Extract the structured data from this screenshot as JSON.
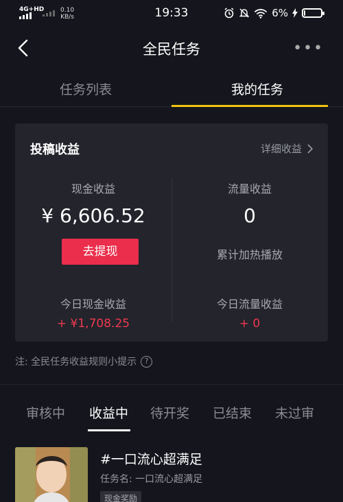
{
  "status_bar": {
    "network": "4G+HD",
    "speed_value": "0.10",
    "speed_unit": "KB/s",
    "time": "19:33",
    "battery_percent": "6%",
    "battery_level": 0.06
  },
  "nav": {
    "title": "全民任务",
    "more": "•••"
  },
  "top_tabs": [
    {
      "label": "任务列表",
      "active": false
    },
    {
      "label": "我的任务",
      "active": true
    }
  ],
  "earnings": {
    "title": "投稿收益",
    "detail_link": "详细收益",
    "cash_label": "现金收益",
    "cash_value": "¥ 6,606.52",
    "withdraw_label": "去提现",
    "traffic_label": "流量收益",
    "traffic_value": "0",
    "traffic_caption": "累计加热播放",
    "today_cash_label": "今日现金收益",
    "today_cash_value": "+ ¥1,708.25",
    "today_traffic_label": "今日流量收益",
    "today_traffic_value": "+ 0"
  },
  "note": {
    "text": "注: 全民任务收益规则小提示"
  },
  "status_tabs": [
    {
      "label": "审核中",
      "active": false
    },
    {
      "label": "收益中",
      "active": true
    },
    {
      "label": "待开奖",
      "active": false
    },
    {
      "label": "已结束",
      "active": false
    },
    {
      "label": "未过审",
      "active": false
    }
  ],
  "task": {
    "title": "#一口流心超满足",
    "name": "任务名: 一口流心超满足",
    "tag": "现金奖励"
  },
  "colors": {
    "background": "#15161d",
    "card": "#23242c",
    "accent_yellow": "#f1c40f",
    "accent_red": "#ea2e4b"
  }
}
